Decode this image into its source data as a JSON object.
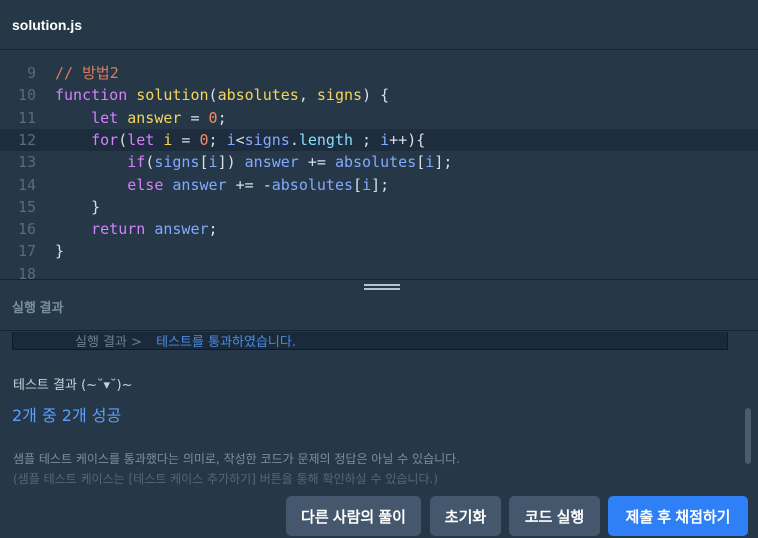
{
  "editor": {
    "filename": "solution.js",
    "lines": [
      {
        "n": "9",
        "tokens": [
          [
            "t-com",
            "// 방법2"
          ]
        ]
      },
      {
        "n": "10",
        "tokens": [
          [
            "t-kw",
            "function "
          ],
          [
            "t-fn",
            "solution"
          ],
          [
            "t-op",
            "("
          ],
          [
            "t-fn",
            "absolutes"
          ],
          [
            "t-op",
            ", "
          ],
          [
            "t-fn",
            "signs"
          ],
          [
            "t-op",
            ") {"
          ]
        ]
      },
      {
        "n": "11",
        "tokens": [
          [
            "t-op",
            "    "
          ],
          [
            "t-kw",
            "let "
          ],
          [
            "t-fn",
            "answer"
          ],
          [
            "t-op",
            " = "
          ],
          [
            "t-num",
            "0"
          ],
          [
            "t-op",
            ";"
          ]
        ]
      },
      {
        "n": "12",
        "active": true,
        "tokens": [
          [
            "t-op",
            "    "
          ],
          [
            "t-kw",
            "for"
          ],
          [
            "t-op",
            "("
          ],
          [
            "t-kw",
            "let "
          ],
          [
            "t-fn",
            "i"
          ],
          [
            "t-op",
            " = "
          ],
          [
            "t-num",
            "0"
          ],
          [
            "t-op",
            "; "
          ],
          [
            "t-var",
            "i"
          ],
          [
            "t-op",
            "<"
          ],
          [
            "t-var",
            "signs"
          ],
          [
            "t-op",
            "."
          ],
          [
            "t-prop",
            "length"
          ],
          [
            "t-op",
            " ; "
          ],
          [
            "t-var",
            "i"
          ],
          [
            "t-op",
            "++){"
          ]
        ]
      },
      {
        "n": "13",
        "tokens": [
          [
            "t-op",
            "        "
          ],
          [
            "t-kw",
            "if"
          ],
          [
            "t-op",
            "("
          ],
          [
            "t-var",
            "signs"
          ],
          [
            "t-op",
            "["
          ],
          [
            "t-var",
            "i"
          ],
          [
            "t-op",
            "]) "
          ],
          [
            "t-var",
            "answer"
          ],
          [
            "t-op",
            " += "
          ],
          [
            "t-var",
            "absolutes"
          ],
          [
            "t-op",
            "["
          ],
          [
            "t-var",
            "i"
          ],
          [
            "t-op",
            "];"
          ]
        ]
      },
      {
        "n": "14",
        "tokens": [
          [
            "t-op",
            "        "
          ],
          [
            "t-kw",
            "else "
          ],
          [
            "t-var",
            "answer"
          ],
          [
            "t-op",
            " += -"
          ],
          [
            "t-var",
            "absolutes"
          ],
          [
            "t-op",
            "["
          ],
          [
            "t-var",
            "i"
          ],
          [
            "t-op",
            "];"
          ]
        ]
      },
      {
        "n": "15",
        "tokens": [
          [
            "t-op",
            "    }"
          ]
        ]
      },
      {
        "n": "16",
        "tokens": [
          [
            "t-op",
            "    "
          ],
          [
            "t-kw",
            "return "
          ],
          [
            "t-var",
            "answer"
          ],
          [
            "t-op",
            ";"
          ]
        ]
      },
      {
        "n": "17",
        "tokens": [
          [
            "t-op",
            "}"
          ]
        ]
      },
      {
        "n": "18",
        "tokens": []
      }
    ]
  },
  "result": {
    "label": "실행 결과",
    "prev_prefix": "실행 결과 >",
    "prev_status": "테스트를 통과하였습니다.",
    "test_title": "테스트 결과 (~˘▾˘)~",
    "test_summary": "2개 중 2개 성공",
    "note1": "샘플 테스트 케이스를 통과했다는 의미로, 작성한 코드가 문제의 정답은 아닐 수 있습니다.",
    "note2": "(샘플 테스트 케이스는 [테스트 케이스 추가하기] 버튼을 통해 확인하실 수 있습니다.)"
  },
  "buttons": {
    "others": "다른 사람의 풀이",
    "reset": "초기화",
    "run": "코드 실행",
    "submit": "제출 후 채점하기"
  },
  "colors": {
    "background": "#263747",
    "button_gray": "#44576c",
    "button_blue": "#2f7ff7",
    "success": "#5aa0ff"
  }
}
